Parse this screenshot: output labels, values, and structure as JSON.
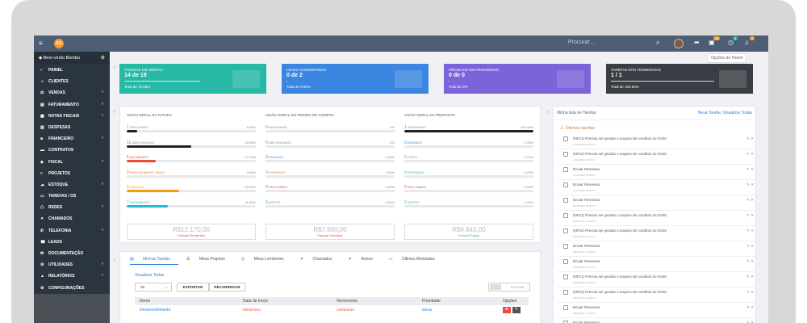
{
  "topbar": {
    "logo_text": "SG",
    "search_placeholder": "Procurar...",
    "badge_tasks": "28",
    "badge_reminders": "5",
    "badge_notifications": "4"
  },
  "sidebar": {
    "welcome": "Bem-vindo Bembo",
    "items": [
      {
        "label": "PAINEL",
        "icon": "gauge-icon",
        "glyph": "◐",
        "chevron": false
      },
      {
        "label": "CLIENTES",
        "icon": "user-icon",
        "glyph": "☺",
        "chevron": false
      },
      {
        "label": "VENDAS",
        "icon": "balance-icon",
        "glyph": "⚖",
        "chevron": true
      },
      {
        "label": "FATURAMENTO",
        "icon": "invoice-icon",
        "glyph": "▤",
        "chevron": true
      },
      {
        "label": "NOTAS FISCAIS",
        "icon": "notes-icon",
        "glyph": "▦",
        "chevron": true
      },
      {
        "label": "DESPESAS",
        "icon": "receipt-icon",
        "glyph": "▥",
        "chevron": false
      },
      {
        "label": "FINANCEIRO",
        "icon": "bank-icon",
        "glyph": "■",
        "chevron": true
      },
      {
        "label": "CONTRATOS",
        "icon": "contract-icon",
        "glyph": "▬",
        "chevron": false
      },
      {
        "label": "FISCAL",
        "icon": "tax-icon",
        "glyph": "◈",
        "chevron": true
      },
      {
        "label": "PROJETOS",
        "icon": "bars-icon",
        "glyph": "≡",
        "chevron": false
      },
      {
        "label": "ESTOQUE",
        "icon": "box-icon",
        "glyph": "☁",
        "chevron": true
      },
      {
        "label": "TAREFAS / OS",
        "icon": "tasks-icon",
        "glyph": "▭",
        "chevron": false
      },
      {
        "label": "REDES",
        "icon": "network-icon",
        "glyph": "☖",
        "chevron": true
      },
      {
        "label": "CHAMADOS",
        "icon": "ticket-icon",
        "glyph": "✦",
        "chevron": false
      },
      {
        "label": "TELEFONIA",
        "icon": "phone-icon",
        "glyph": "✆",
        "chevron": true
      },
      {
        "label": "LEADS",
        "icon": "tty-icon",
        "glyph": "☎",
        "chevron": false
      },
      {
        "label": "DOCUMENTAÇÃO",
        "icon": "doc-icon",
        "glyph": "✉",
        "chevron": false
      },
      {
        "label": "UTILIDADES",
        "icon": "cogs-icon",
        "glyph": "⚙",
        "chevron": true
      },
      {
        "label": "RELATÓRIOS",
        "icon": "chart-icon",
        "glyph": "▲",
        "chevron": true
      },
      {
        "label": "CONFIGURAÇÕES",
        "icon": "gear-icon",
        "glyph": "⚙",
        "chevron": false
      }
    ]
  },
  "options_panel": "Opções do Painel",
  "stats": [
    {
      "title": "FATURAS EM ABERTO",
      "value": "14 de 19",
      "footer": "Total de 73.68%",
      "color": "#27b8a6",
      "bar": 0.7368
    },
    {
      "title": "LEADS CONVERTIDOS",
      "value": "0 de 2",
      "footer": "Total de 0.00%",
      "color": "#3b86e0",
      "bar": 0
    },
    {
      "title": "PROJETOS EM PROGRESSO",
      "value": "0 de 0",
      "footer": "Total de 0%",
      "color": "#7b63d9",
      "bar": 0
    },
    {
      "title": "TAREFAS NÃO TERMINADAS",
      "value": "1 / 1",
      "footer": "Total de 100.00%",
      "color": "#3a3e44",
      "bar": 1
    }
  ],
  "overview": {
    "titles": [
      "VISÃO GERAL DA FATURA",
      "VISÃO GERAL DO PEDIDO DE COMPRA",
      "VISÃO GERAL DA PROPOSTA"
    ],
    "cols": [
      [
        {
          "count": "1",
          "label": "RASCUNHO",
          "pct": "8.33%",
          "value": 8.33,
          "color": "#222222",
          "text_color": "#888888"
        },
        {
          "count": "11",
          "label": "NÃO ENVIADO",
          "pct": "50.00%",
          "value": 50,
          "color": "#222222",
          "text_color": "#888888"
        },
        {
          "count": "5",
          "label": "EM ABERTO",
          "pct": "22.73%",
          "value": 22.73,
          "color": "#e74c3c",
          "text_color": "#e74c3c"
        },
        {
          "count": "0",
          "label": "PARCIALMENTE PAGO",
          "pct": "0.00%",
          "value": 0,
          "color": "#e67e22",
          "text_color": "#e67e22"
        },
        {
          "count": "9",
          "label": "VENCIDO",
          "pct": "40.91%",
          "value": 40.91,
          "color": "#f39c12",
          "text_color": "#f39c12"
        },
        {
          "count": "7",
          "label": "PAGAMENTO",
          "pct": "31.82%",
          "value": 31.82,
          "color": "#27b8d6",
          "text_color": "#27b8a6"
        }
      ],
      [
        {
          "count": "0",
          "label": "RASCUNHO",
          "pct": "0%",
          "value": 0,
          "color": "#222222",
          "text_color": "#888888"
        },
        {
          "count": "0",
          "label": "NÃO ENVIADO",
          "pct": "0%",
          "value": 0,
          "color": "#222222",
          "text_color": "#888888"
        },
        {
          "count": "0",
          "label": "ENVIADO",
          "pct": "0.00%",
          "value": 0,
          "color": "#3b86e0",
          "text_color": "#3b86e0"
        },
        {
          "count": "0",
          "label": "EXPIRADO",
          "pct": "0.00%",
          "value": 0,
          "color": "#e67e22",
          "text_color": "#e67e22"
        },
        {
          "count": "0",
          "label": "DECLINADO",
          "pct": "0.00%",
          "value": 0,
          "color": "#e74c3c",
          "text_color": "#e74c3c"
        },
        {
          "count": "0",
          "label": "ACEITO",
          "pct": "0.00%",
          "value": 0,
          "color": "#27b8a6",
          "text_color": "#27b8a6"
        }
      ],
      [
        {
          "count": "1",
          "label": "RASCUNHO",
          "pct": "100.00%",
          "value": 100,
          "color": "#222222",
          "text_color": "#888888"
        },
        {
          "count": "0",
          "label": "ENVIADO",
          "pct": "0.00%",
          "value": 0,
          "color": "#3b86e0",
          "text_color": "#3b86e0"
        },
        {
          "count": "0",
          "label": "VISTO",
          "pct": "0.00%",
          "value": 0,
          "color": "#888888",
          "text_color": "#888888"
        },
        {
          "count": "0",
          "label": "REVISADO",
          "pct": "0.00%",
          "value": 0,
          "color": "#27b8a6",
          "text_color": "#27b8a6"
        },
        {
          "count": "0",
          "label": "DECLINADO",
          "pct": "0.00%",
          "value": 0,
          "color": "#e74c3c",
          "text_color": "#e74c3c"
        },
        {
          "count": "0",
          "label": "ACEITO",
          "pct": "0.00%",
          "value": 0,
          "color": "#27b8a6",
          "text_color": "#27b8a6"
        }
      ]
    ],
    "money": [
      {
        "value": "R$12.170,00",
        "label": "Faturas Pendentes",
        "label_color": "#e74c3c"
      },
      {
        "value": "R$7.980,00",
        "label": "Faturas Vencidas",
        "label_color": "#e74c3c"
      },
      {
        "value": "R$6.840,00",
        "label": "Faturas Pagas",
        "label_color": "#27b8a6"
      }
    ]
  },
  "tasks_panel": {
    "tabs": [
      "Minhas Tarefas",
      "Meus Projetos",
      "Meus Lembretes",
      "Chamados",
      "Avisos",
      "Últimas Atividades"
    ],
    "view_all": "Visualizar Todas",
    "page_size": "25",
    "export": "EXPORTAR",
    "reload": "RECARREGAR",
    "search_placeholder": "Procurar",
    "columns": [
      "Nome",
      "Data de Início",
      "Vencimento",
      "Prioridade",
      "Opções"
    ],
    "row": {
      "name": "Desenvolvimento",
      "start": "09/03/2021",
      "due": "10/06/2021",
      "priority": "Média"
    }
  },
  "todo": {
    "title": "Minha lista de Tarefas",
    "new_task": "Nova Tarefa",
    "view_all": "Visualizar Todas",
    "section": "Últimas tarefas",
    "items": [
      {
        "text": "(NF21) Precisa ser gerado o arquivo de condinto do ICMS",
        "date": "17/11/2020 15:45:01"
      },
      {
        "text": "(NF22) Precisa ser gerado o arquivo de condinto do ICMS",
        "date": "17/11/2020 15:45:47"
      },
      {
        "text": "Enviar Remessa",
        "date": "17/11/2020 15:46:01"
      },
      {
        "text": "Enviar Remessa",
        "date": "17/11/2020 15:46:19"
      },
      {
        "text": "Enviar Remessa",
        "date": "17/11/2020 15:46:37"
      },
      {
        "text": "(NF21) Precisa ser gerado o arquivo de condinto do ICMS",
        "date": "19/01/2021 11:26:22"
      },
      {
        "text": "(NF22) Precisa ser gerado o arquivo de condinto do ICMS",
        "date": "19/01/2021 11:26:27"
      },
      {
        "text": "Enviar Remessa",
        "date": "19/01/2021 11:26:33"
      },
      {
        "text": "Enviar Remessa",
        "date": "19/01/2021 11:26:37"
      },
      {
        "text": "(NF21) Precisa ser gerado o arquivo de condinto do ICMS",
        "date": "09/03/2021 11:39:07"
      },
      {
        "text": "(NF22) Precisa ser gerado o arquivo de condinto do ICMS",
        "date": "09/03/2021 11:39:27"
      },
      {
        "text": "Enviar Remessa",
        "date": "09/03/2021 11:39:35"
      },
      {
        "text": "Enviar Remessa",
        "date": "09/03/2021 11:39:45"
      }
    ]
  }
}
